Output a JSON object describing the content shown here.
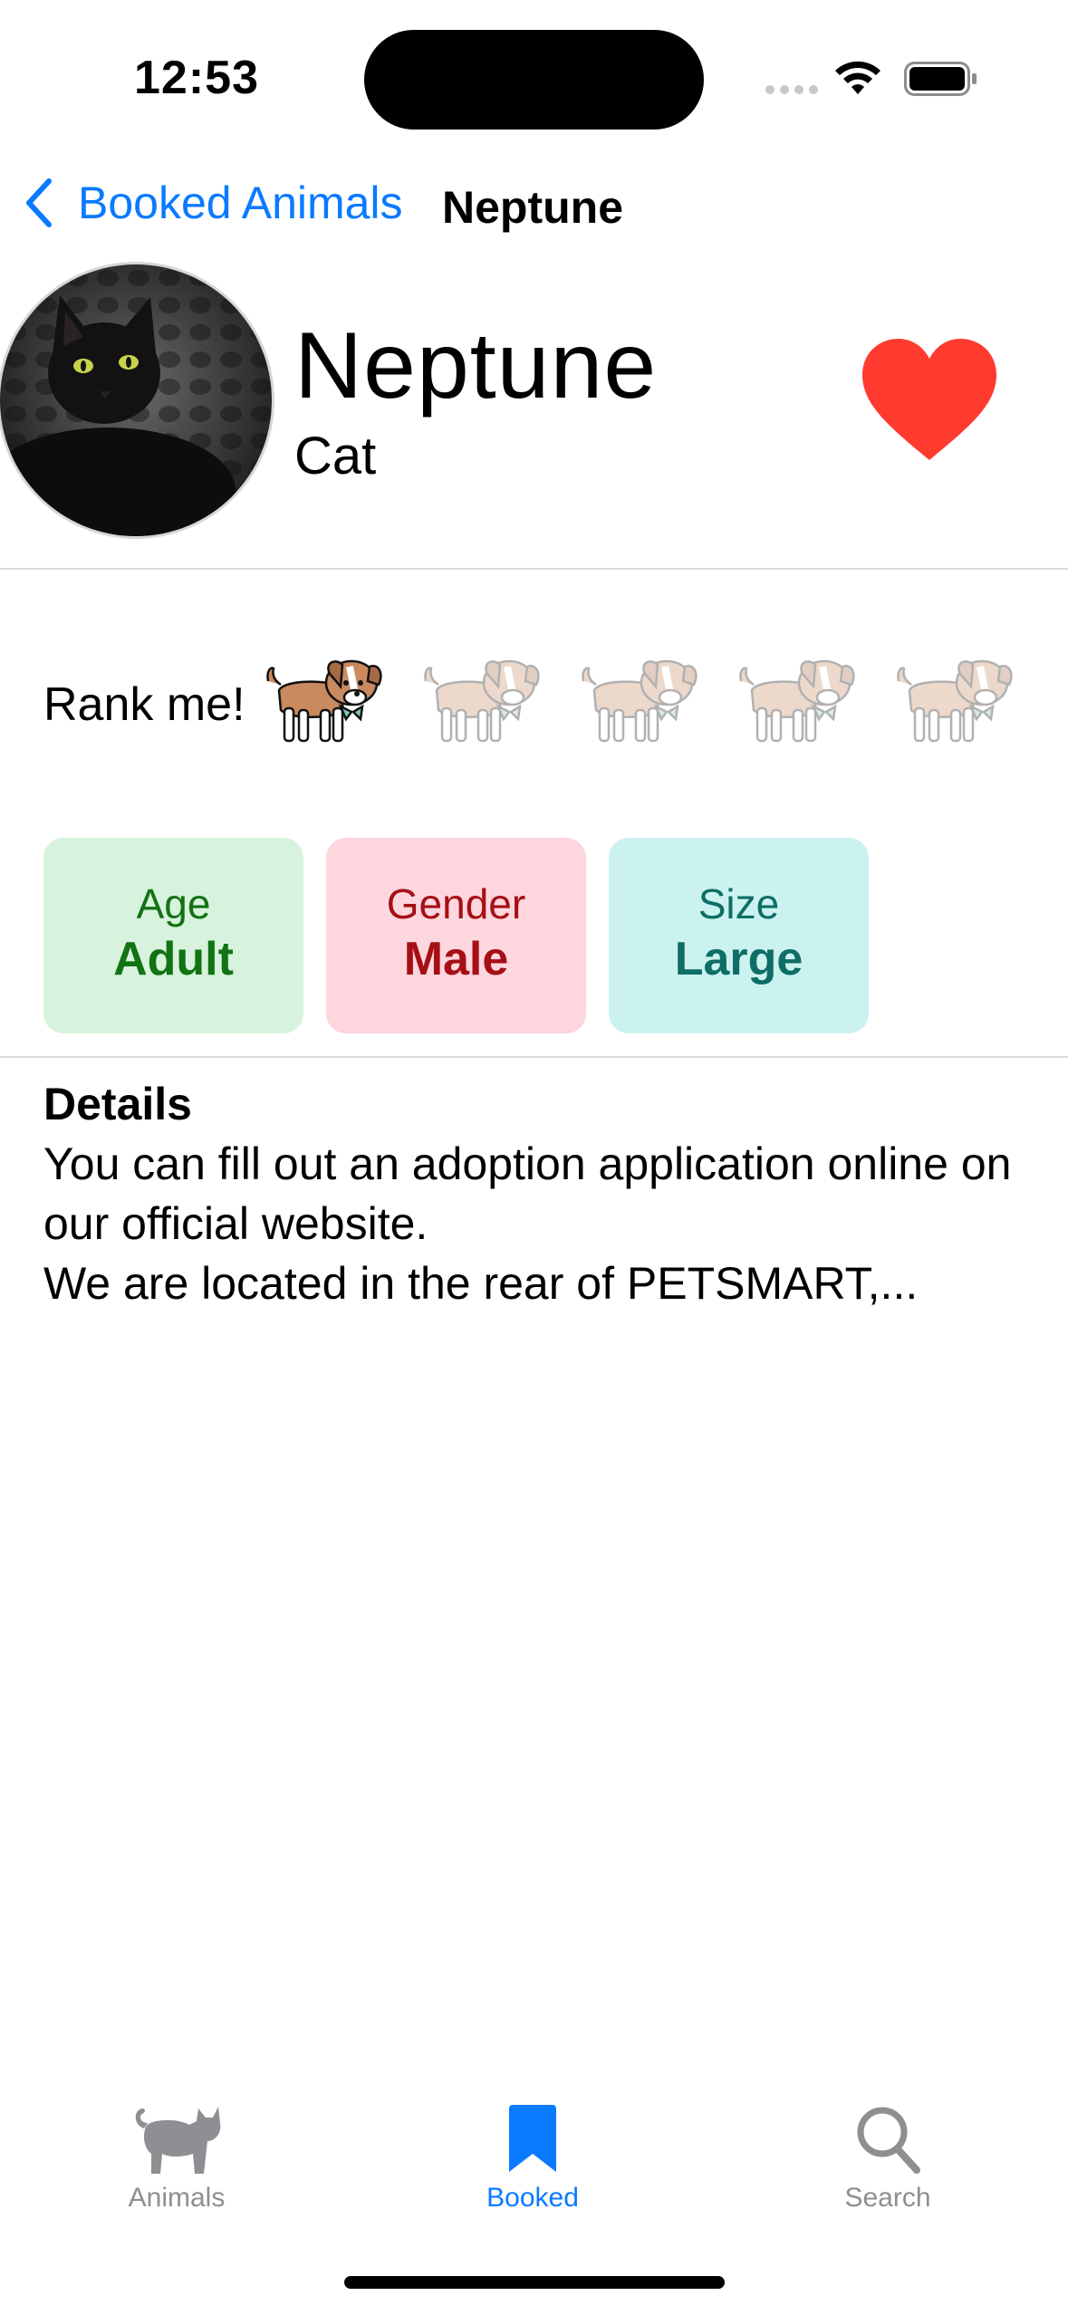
{
  "status_bar": {
    "time": "12:53",
    "icons": [
      "cellular-signal-icon",
      "wifi-icon",
      "battery-icon"
    ]
  },
  "nav": {
    "back_label": "Booked Animals",
    "title": "Neptune",
    "back_icon": "chevron-left-icon"
  },
  "animal": {
    "name": "Neptune",
    "species": "Cat",
    "photo": "black-cat-photo",
    "favorite": true,
    "favorite_icon": "heart-icon",
    "favorite_color": "#ff3b30"
  },
  "rank": {
    "label": "Rank me!",
    "max": 5,
    "value": 1,
    "icon": "puppy-icon"
  },
  "info": {
    "age": {
      "label": "Age",
      "value": "Adult"
    },
    "gender": {
      "label": "Gender",
      "value": "Male"
    },
    "size": {
      "label": "Size",
      "value": "Large"
    }
  },
  "details": {
    "title": "Details",
    "text": "You can fill out an adoption application online on our official website.\nWe are located in the rear of PETSMART,..."
  },
  "tabs": [
    {
      "label": "Animals",
      "icon": "cat-icon",
      "selected": false
    },
    {
      "label": "Booked",
      "icon": "bookmark-icon",
      "selected": true
    },
    {
      "label": "Search",
      "icon": "magnifier-icon",
      "selected": false
    }
  ],
  "colors": {
    "accent": "#0a7aff",
    "inactive": "#8e8e93",
    "age_bg": "#d8f3dd",
    "gender_bg": "#fdd6de",
    "size_bg": "#ccf2f0"
  }
}
